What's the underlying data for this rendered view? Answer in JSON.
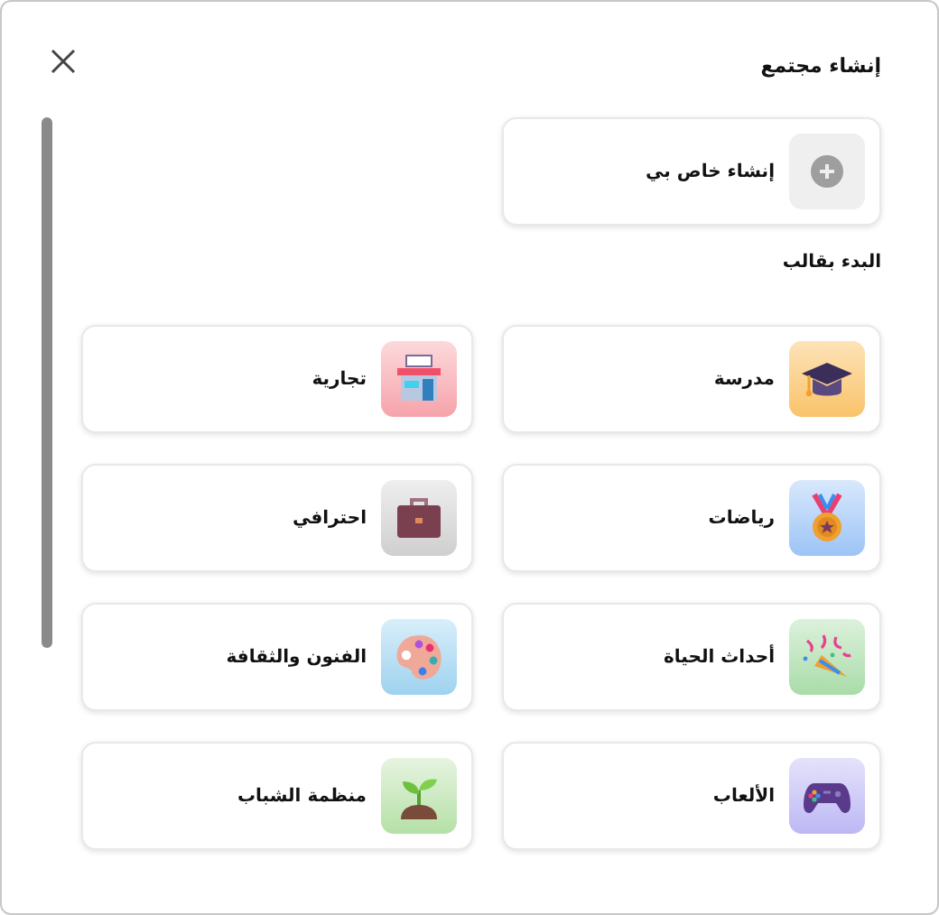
{
  "dialog": {
    "title": "إنشاء مجتمع"
  },
  "create_card": {
    "label": "إنشاء خاص بي"
  },
  "templates_heading": "البدء بقالب",
  "templates": [
    {
      "label": "مدرسة",
      "kind": "school"
    },
    {
      "label": "تجارية",
      "kind": "business"
    },
    {
      "label": "رياضات",
      "kind": "sports"
    },
    {
      "label": "احترافي",
      "kind": "professional"
    },
    {
      "label": "أحداث الحياة",
      "kind": "events"
    },
    {
      "label": "الفنون والثقافة",
      "kind": "arts"
    },
    {
      "label": "الألعاب",
      "kind": "games"
    },
    {
      "label": "منظمة الشباب",
      "kind": "youth"
    }
  ]
}
